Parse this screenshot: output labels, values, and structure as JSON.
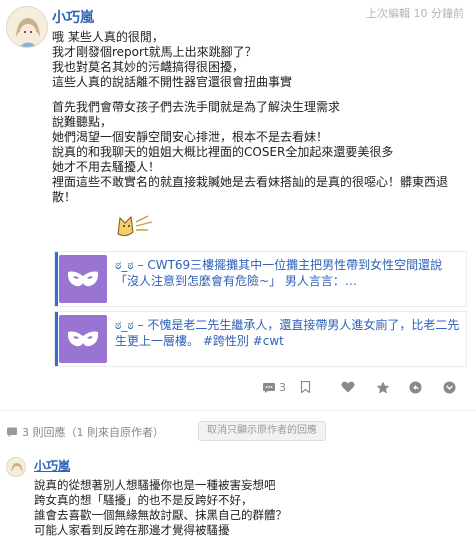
{
  "post": {
    "author": "小巧嵐",
    "edited": "上次編輯 10 分鐘前",
    "paragraph1": [
      "哦 某些人真的很閒，",
      "我才剛發個report就馬上出來跳腳了？",
      "我也對莫名其妙的污衊搞得很困擾，",
      "這些人真的說話離不開性器官還很會扭曲事實"
    ],
    "paragraph2": [
      "首先我們會帶女孩子們去洗手間就是為了解決生理需求",
      "說難聽點，",
      "她們渴望一個安靜空間安心排泄，根本不是去看妹！",
      "說真的和我聊天的姐姐大概比裡面的COSER全加起來還要美很多",
      "她才不用去騷擾人！",
      "裡面這些不敢實名的就直接栽贓她是去看妹搭訕的是真的很噁心！髒東西退散！"
    ],
    "link_cards": [
      {
        "text": "ಠ_ಠ – CWT69三樓擺攤其中一位攤主把男性帶到女性空間還說「沒人注意到怎麼會有危險~」 男人言言：…",
        "thumb_icon": "mask-icon"
      },
      {
        "text": "ಠ_ಠ – 不愧是老二先生繼承人，還直接帶男人進女廁了，比老二先生更上一層樓。 #跨性別 #cwt",
        "thumb_icon": "mask-icon"
      }
    ],
    "actions": {
      "comment_count": "3"
    }
  },
  "replies": {
    "summary": "3 則回應（1 則來自原作者）",
    "cancel_label": "取消只顯示原作者的回應"
  },
  "comment": {
    "author": "小巧嵐",
    "lines": [
      "說真的從想著別人想騷擾你也是一種被害妄想吧",
      "跨女真的想「騷擾」的也不是反跨好不好，",
      "誰會去喜歡一個無緣無故討厭、抹黑自己的群體？",
      "可能人家看到反跨在那邊才覺得被騷擾"
    ]
  },
  "colors": {
    "link": "#2f62b8",
    "accent_bar": "#2f6fd6",
    "thumb_bg": "#9a74d3",
    "muted": "#8a8a8a"
  }
}
